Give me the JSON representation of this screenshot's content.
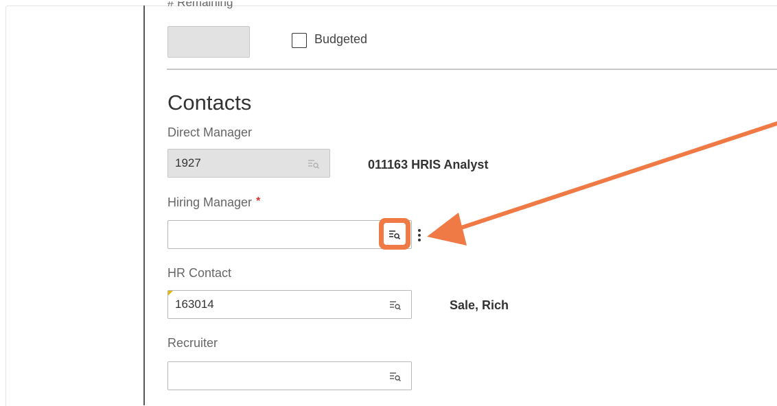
{
  "header": {
    "remaining_label": "# Remaining"
  },
  "budgeted": {
    "label": "Budgeted",
    "checked": false
  },
  "contacts": {
    "title": "Contacts",
    "direct_manager": {
      "label": "Direct Manager",
      "value": "1927",
      "description": "011163 HRIS Analyst"
    },
    "hiring_manager": {
      "label": "Hiring Manager",
      "required_mark": "*",
      "value": ""
    },
    "hr_contact": {
      "label": "HR Contact",
      "value": "163014",
      "description": "Sale, Rich"
    },
    "recruiter": {
      "label": "Recruiter",
      "value": ""
    }
  },
  "icons": {
    "lookup": "lookup-icon",
    "more": "kebab-menu-icon",
    "checkbox": "checkbox-icon",
    "annotation": "arrow-annotation"
  },
  "colors": {
    "annotation": "#f07a45",
    "required": "#d9342b",
    "dirty_flag": "#e8b60a",
    "disabled_field": "#e2e2e2"
  }
}
